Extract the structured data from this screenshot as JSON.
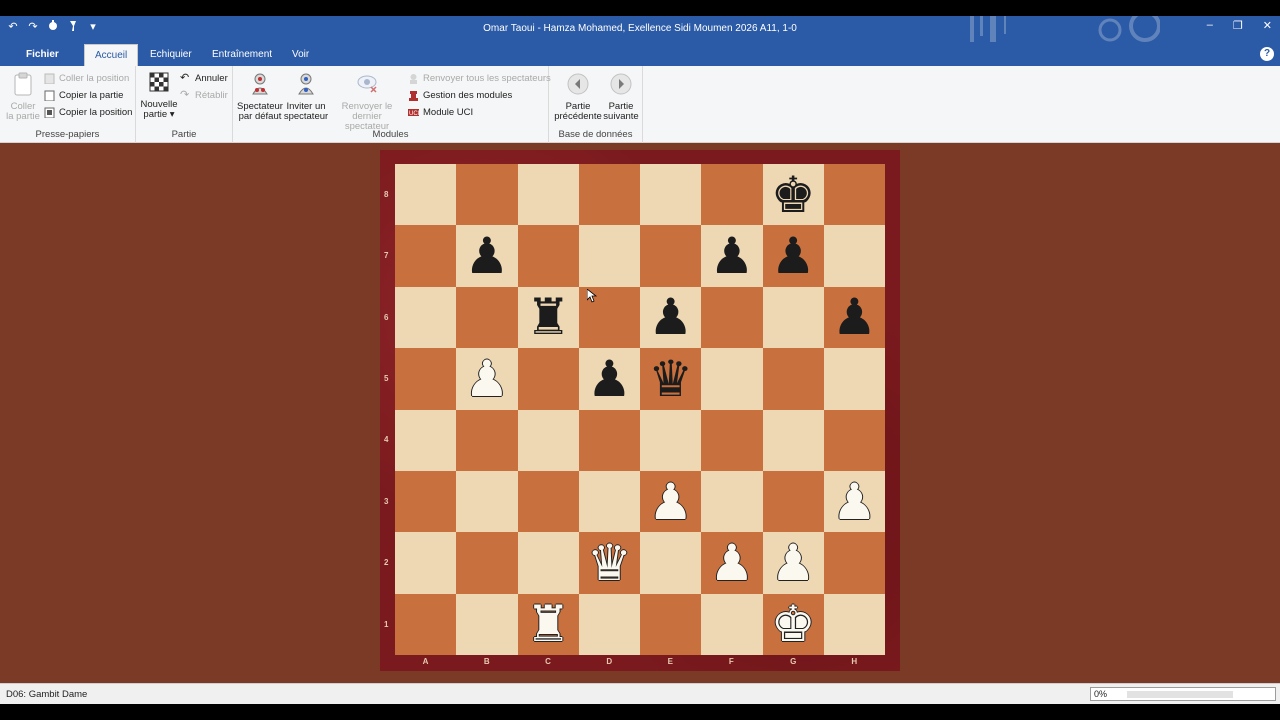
{
  "window": {
    "title": "Omar Taoui - Hamza Mohamed, Exellence Sidi Moumen 2026  A11, 1-0",
    "minimize": "–",
    "restore": "❐",
    "close": "✕"
  },
  "quick_access": [
    "undo-icon",
    "redo-icon",
    "engine-icon",
    "tools-icon",
    "customize-icon"
  ],
  "tabs": {
    "file": "Fichier",
    "home": "Accueil",
    "board": "Echiquier",
    "training": "Entraînement",
    "view": "Voir",
    "help": "?"
  },
  "ribbon": {
    "clipboard": {
      "label": "Presse-papiers",
      "paste_game": "Coller\nla partie",
      "paste_game_line1": "Coller",
      "paste_game_line2": "la partie",
      "paste_position": "Coller la position",
      "copy_game": "Copier la partie",
      "copy_position": "Copier la position"
    },
    "game": {
      "label": "Partie",
      "new_game_line1": "Nouvelle",
      "new_game_line2": "partie",
      "undo": "Annuler",
      "redo": "Rétablir"
    },
    "modules": {
      "label": "Modules",
      "default_spectator_line1": "Spectateur",
      "default_spectator_line2": "par défaut",
      "invite_spectator_line1": "Inviter un",
      "invite_spectator_line2": "spectateur",
      "remove_last_line1": "Renvoyer le",
      "remove_last_line2": "dernier spectateur",
      "remove_all": "Renvoyer tous les spectateurs",
      "manage_modules": "Gestion des modules",
      "uci_module": "Module UCI"
    },
    "database": {
      "label": "Base de données",
      "prev_game_line1": "Partie",
      "prev_game_line2": "précédente",
      "next_game_line1": "Partie",
      "next_game_line2": "suivante"
    }
  },
  "board": {
    "files": [
      "A",
      "B",
      "C",
      "D",
      "E",
      "F",
      "G",
      "H"
    ],
    "ranks": [
      "8",
      "7",
      "6",
      "5",
      "4",
      "3",
      "2",
      "1"
    ],
    "pieces": [
      {
        "square": "g8",
        "color": "black",
        "type": "king",
        "glyph": "♚"
      },
      {
        "square": "b7",
        "color": "black",
        "type": "pawn",
        "glyph": "♟"
      },
      {
        "square": "f7",
        "color": "black",
        "type": "pawn",
        "glyph": "♟"
      },
      {
        "square": "g7",
        "color": "black",
        "type": "pawn",
        "glyph": "♟"
      },
      {
        "square": "c6",
        "color": "black",
        "type": "rook",
        "glyph": "♜"
      },
      {
        "square": "e6",
        "color": "black",
        "type": "pawn",
        "glyph": "♟"
      },
      {
        "square": "h6",
        "color": "black",
        "type": "pawn",
        "glyph": "♟"
      },
      {
        "square": "b5",
        "color": "white",
        "type": "pawn",
        "glyph": "♟"
      },
      {
        "square": "d5",
        "color": "black",
        "type": "pawn",
        "glyph": "♟"
      },
      {
        "square": "e5",
        "color": "black",
        "type": "queen",
        "glyph": "♛"
      },
      {
        "square": "e3",
        "color": "white",
        "type": "pawn",
        "glyph": "♟"
      },
      {
        "square": "h3",
        "color": "white",
        "type": "pawn",
        "glyph": "♟"
      },
      {
        "square": "d2",
        "color": "white",
        "type": "queen",
        "glyph": "♛"
      },
      {
        "square": "f2",
        "color": "white",
        "type": "pawn",
        "glyph": "♟"
      },
      {
        "square": "g2",
        "color": "white",
        "type": "pawn",
        "glyph": "♟"
      },
      {
        "square": "c1",
        "color": "white",
        "type": "rook",
        "glyph": "♜"
      },
      {
        "square": "g1",
        "color": "white",
        "type": "king",
        "glyph": "♚"
      }
    ]
  },
  "status": {
    "opening": "D06: Gambit Dame",
    "progress_text": "0%",
    "progress": 0
  },
  "colors": {
    "accent": "#2b5aa6",
    "light_square": "#eed8b4",
    "dark_square": "#c9703f",
    "frame": "#7a1a1e",
    "background": "#7a3a25"
  }
}
